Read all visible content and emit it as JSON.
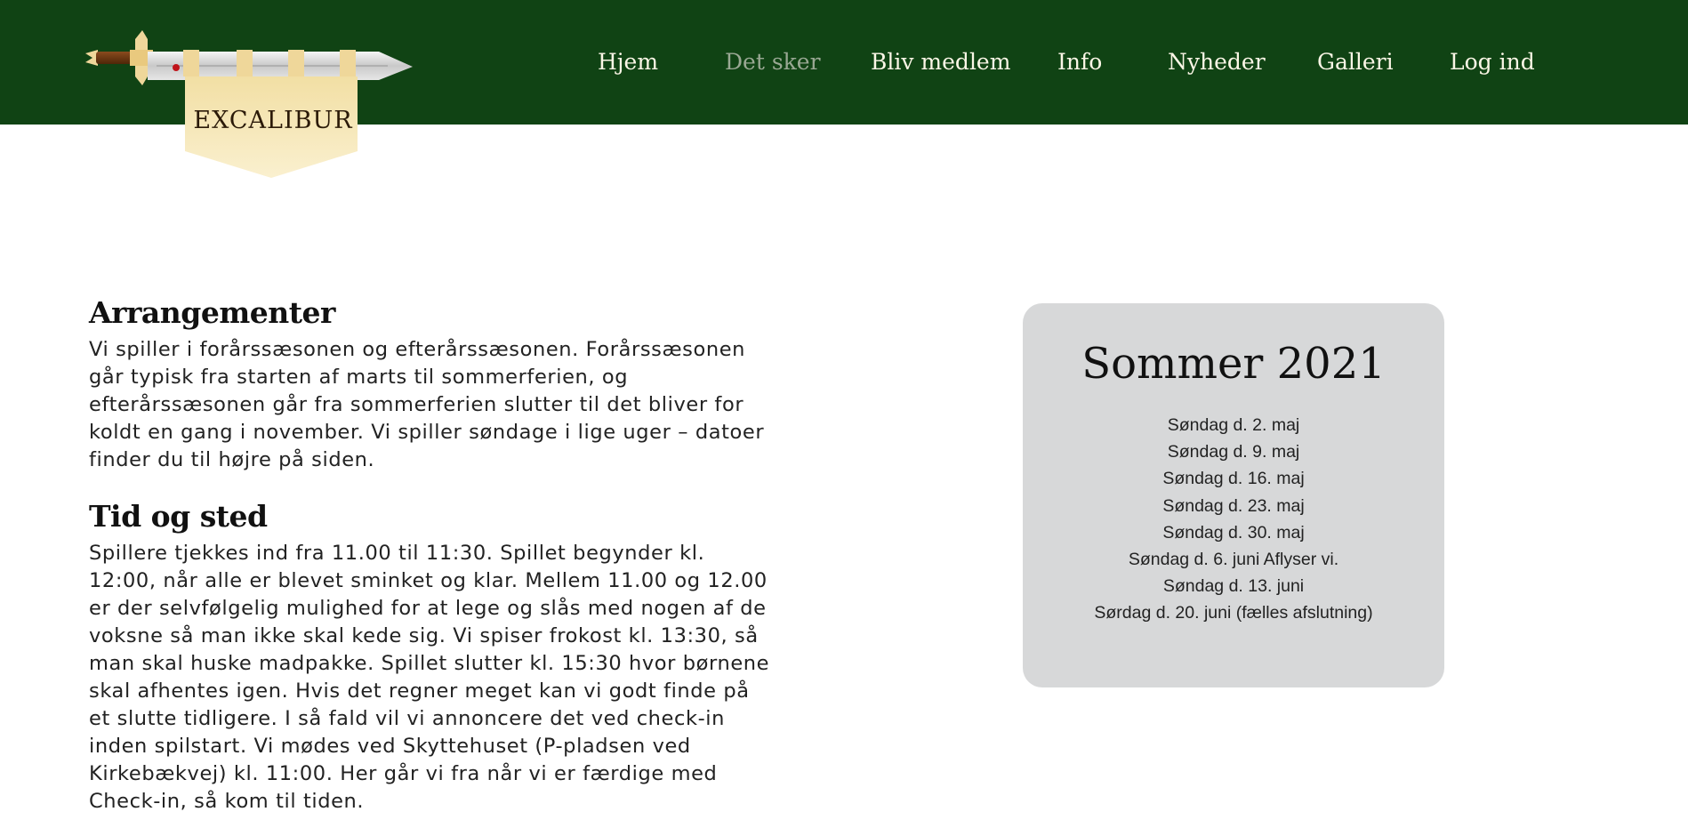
{
  "site": {
    "logo_text": "EXCALIBUR",
    "colors": {
      "header_bg": "#104314",
      "nav_text": "#fbf6e6",
      "nav_active": "#9aa894",
      "card_bg": "#d7d8d9"
    }
  },
  "nav": {
    "items": [
      {
        "label": "Hjem",
        "active": false
      },
      {
        "label": "Det sker",
        "active": true
      },
      {
        "label": "Bliv medlem",
        "active": false
      },
      {
        "label": "Info",
        "active": false
      },
      {
        "label": "Nyheder",
        "active": false
      },
      {
        "label": "Galleri",
        "active": false
      },
      {
        "label": "Log ind",
        "active": false
      }
    ]
  },
  "main": {
    "sections": [
      {
        "heading": "Arrangementer",
        "text": "Vi spiller i forårssæsonen og efterårssæsonen. Forårssæsonen går typisk fra starten af marts til sommerferien, og efterårssæsonen går fra sommerferien slutter til det bliver for koldt en gang i november. Vi spiller søndage i lige uger – datoer finder du til højre på siden."
      },
      {
        "heading": "Tid og sted",
        "text": "Spillere tjekkes ind fra 11.00 til 11:30. Spillet begynder kl. 12:00, når alle er blevet sminket og klar. Mellem 11.00 og 12.00 er der selvfølgelig mulighed for at lege og slås med nogen af de voksne så man ikke skal kede sig. Vi spiser frokost kl. 13:30, så man skal huske madpakke. Spillet slutter kl. 15:30 hvor børnene skal afhentes igen. Hvis det regner meget kan vi godt finde på et slutte tidligere. I så fald vil vi annoncere det ved check-in inden spilstart. Vi mødes ved Skyttehuset (P-pladsen ved Kirkebækvej) kl. 11:00. Her går vi fra når vi er færdige med Check-in, så kom til tiden."
      }
    ]
  },
  "schedule": {
    "title": "Sommer 2021",
    "dates": [
      "Søndag d. 2. maj",
      "Søndag d. 9. maj",
      "Søndag d. 16. maj",
      "Søndag d. 23. maj",
      "Søndag d. 30. maj",
      "Søndag d. 6. juni Aflyser vi.",
      "Søndag d. 13. juni",
      "Sørdag d. 20. juni (fælles afslutning)"
    ]
  }
}
